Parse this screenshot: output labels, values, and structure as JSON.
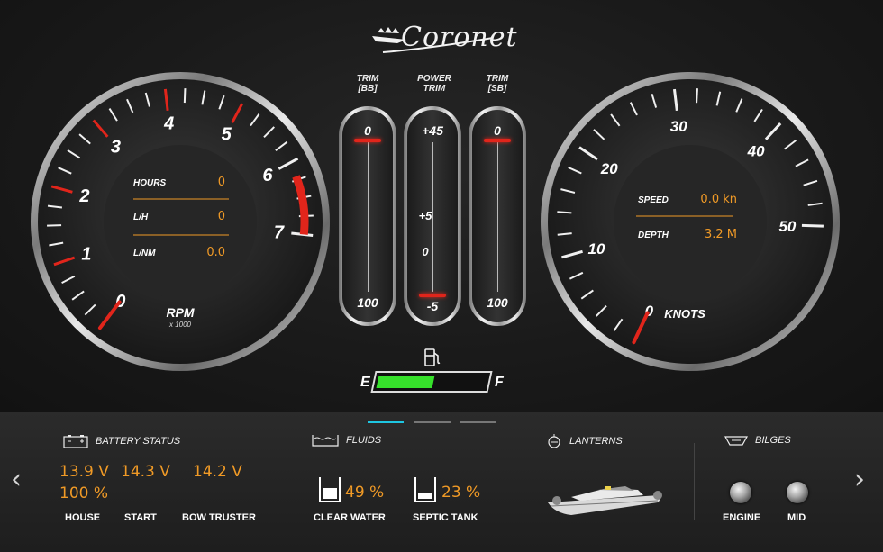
{
  "brand": {
    "name": "Coronet"
  },
  "tachometer": {
    "tick_labels": [
      "0",
      "1",
      "2",
      "3",
      "4",
      "5",
      "6",
      "7"
    ],
    "readouts": [
      {
        "label": "HOURS",
        "value": "0"
      },
      {
        "label": "L/H",
        "value": "0"
      },
      {
        "label": "L/NM",
        "value": "0.0"
      }
    ],
    "unit_label": "RPM",
    "unit_sub": "x 1000",
    "needle_value": 0,
    "redline_from": 6.2,
    "max": 7,
    "accent_color": "#e1251b"
  },
  "speedometer": {
    "tick_labels": [
      "0",
      "10",
      "20",
      "30",
      "40",
      "50"
    ],
    "readouts": [
      {
        "label": "SPEED",
        "value": "0.0 kn"
      },
      {
        "label": "DEPTH",
        "value": "3.2 M"
      }
    ],
    "unit_label": "KNOTS",
    "needle_value": 0,
    "max": 50
  },
  "trim": [
    {
      "title_line1": "TRIM",
      "title_line2": "[BB]",
      "top": "0",
      "bottom": "100",
      "position": 0
    },
    {
      "title_line1": "POWER",
      "title_line2": "TRIM",
      "top": "+45",
      "mid1": "+5",
      "mid2": "0",
      "bottom": "-5",
      "position": 1
    },
    {
      "title_line1": "TRIM",
      "title_line2": "[SB]",
      "top": "0",
      "bottom": "100",
      "position": 0
    }
  ],
  "fuel": {
    "empty_label": "E",
    "full_label": "F",
    "level": 0.5,
    "bar_color": "#36e12b",
    "icon": "fuel-pump-icon"
  },
  "pager": {
    "pages": 3,
    "active": 0,
    "active_color": "#1ec6e2"
  },
  "battery": {
    "title": "BATTERY STATUS",
    "icon": "battery-icon",
    "values": [
      "13.9 V",
      "14.3 V",
      "14.2 V"
    ],
    "house_percent": "100 %",
    "labels": [
      "HOUSE",
      "START",
      "BOW TRUSTER"
    ]
  },
  "fluids": {
    "title": "FLUIDS",
    "icon": "tank-icon",
    "tanks": [
      {
        "label": "CLEAR WATER",
        "value": "49 %",
        "level": 0.49
      },
      {
        "label": "SEPTIC TANK",
        "value": "23 %",
        "level": 0.23
      }
    ]
  },
  "lanterns": {
    "title": "LANTERNS",
    "icon": "lantern-icon",
    "boat_icon": "boat-icon"
  },
  "bilges": {
    "title": "BILGES",
    "icon": "bilge-icon",
    "pumps": [
      "ENGINE",
      "MID"
    ]
  },
  "nav": {
    "prev_icon": "chevron-left-icon",
    "next_icon": "chevron-right-icon",
    "prev": "‹",
    "next": "›"
  },
  "colors": {
    "readout": "#f09a26",
    "redline": "#e1251b"
  }
}
